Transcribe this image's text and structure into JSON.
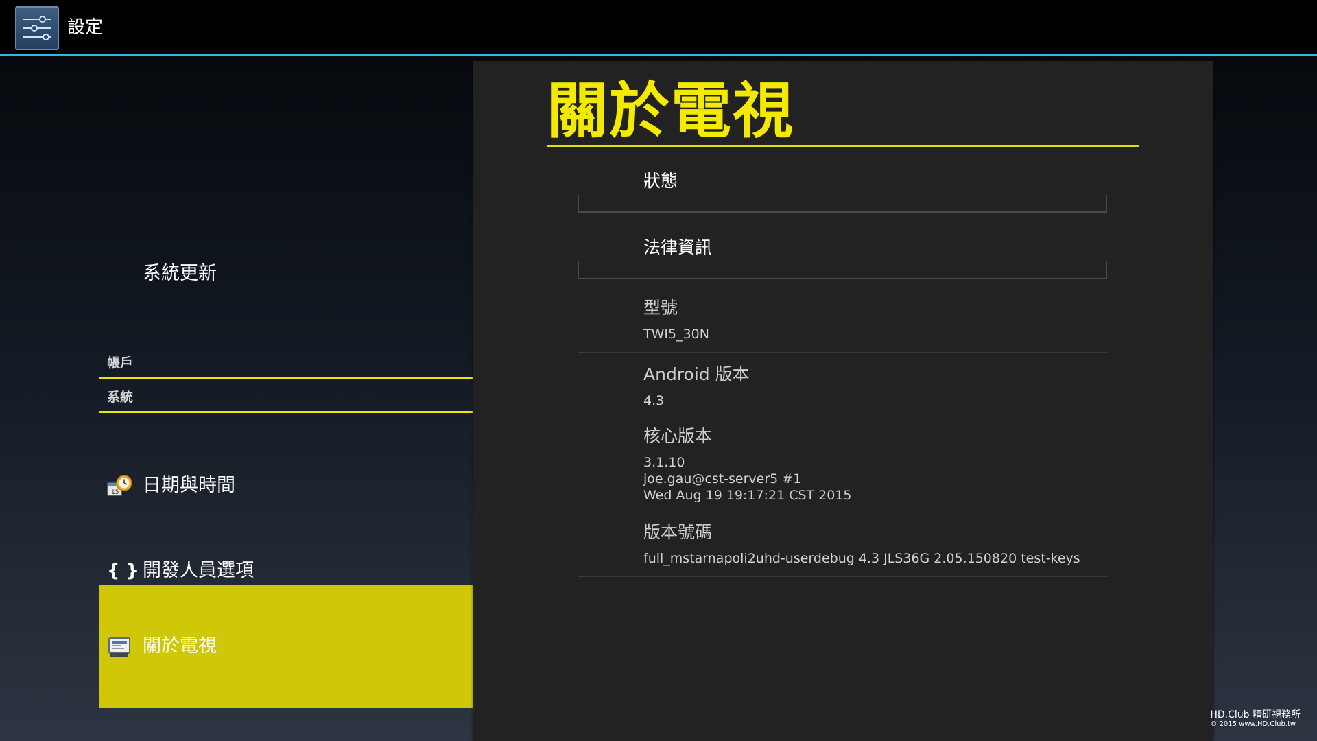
{
  "actionbar": {
    "app_icon": "settings-sliders-icon",
    "title": "設定",
    "accent_color": "#33b5e5"
  },
  "sidebar": {
    "items": [
      {
        "label": "系統更新"
      },
      {
        "label": "日期與時間",
        "icon": "clock-calendar-icon"
      },
      {
        "label": "開發人員選項",
        "icon": "{ }"
      },
      {
        "label": "關於電視",
        "icon": "tv-info-icon",
        "selected": true
      }
    ],
    "headers": [
      "帳戶",
      "系統"
    ],
    "selected_color": "#cfc708",
    "header_underline_color": "#f2e200"
  },
  "detail": {
    "title": "關於電視",
    "title_color": "#f4ea00",
    "prefs": [
      {
        "title": "狀態"
      },
      {
        "title": "法律資訊"
      },
      {
        "title": "型號",
        "summary": [
          "TWI5_30N"
        ]
      },
      {
        "title": "Android 版本",
        "summary": [
          "4.3"
        ]
      },
      {
        "title": "核心版本",
        "summary": [
          "3.1.10",
          "joe.gau@cst-server5 #1",
          "Wed Aug 19 19:17:21 CST 2015"
        ]
      },
      {
        "title": "版本號碼",
        "summary": [
          "full_mstarnapoli2uhd-userdebug 4.3 JLS36G 2.05.150820 test-keys"
        ]
      }
    ]
  },
  "watermark": {
    "line1": "HD.Club 精研視務所",
    "line2": "© 2015  www.HD.Club.tw"
  }
}
